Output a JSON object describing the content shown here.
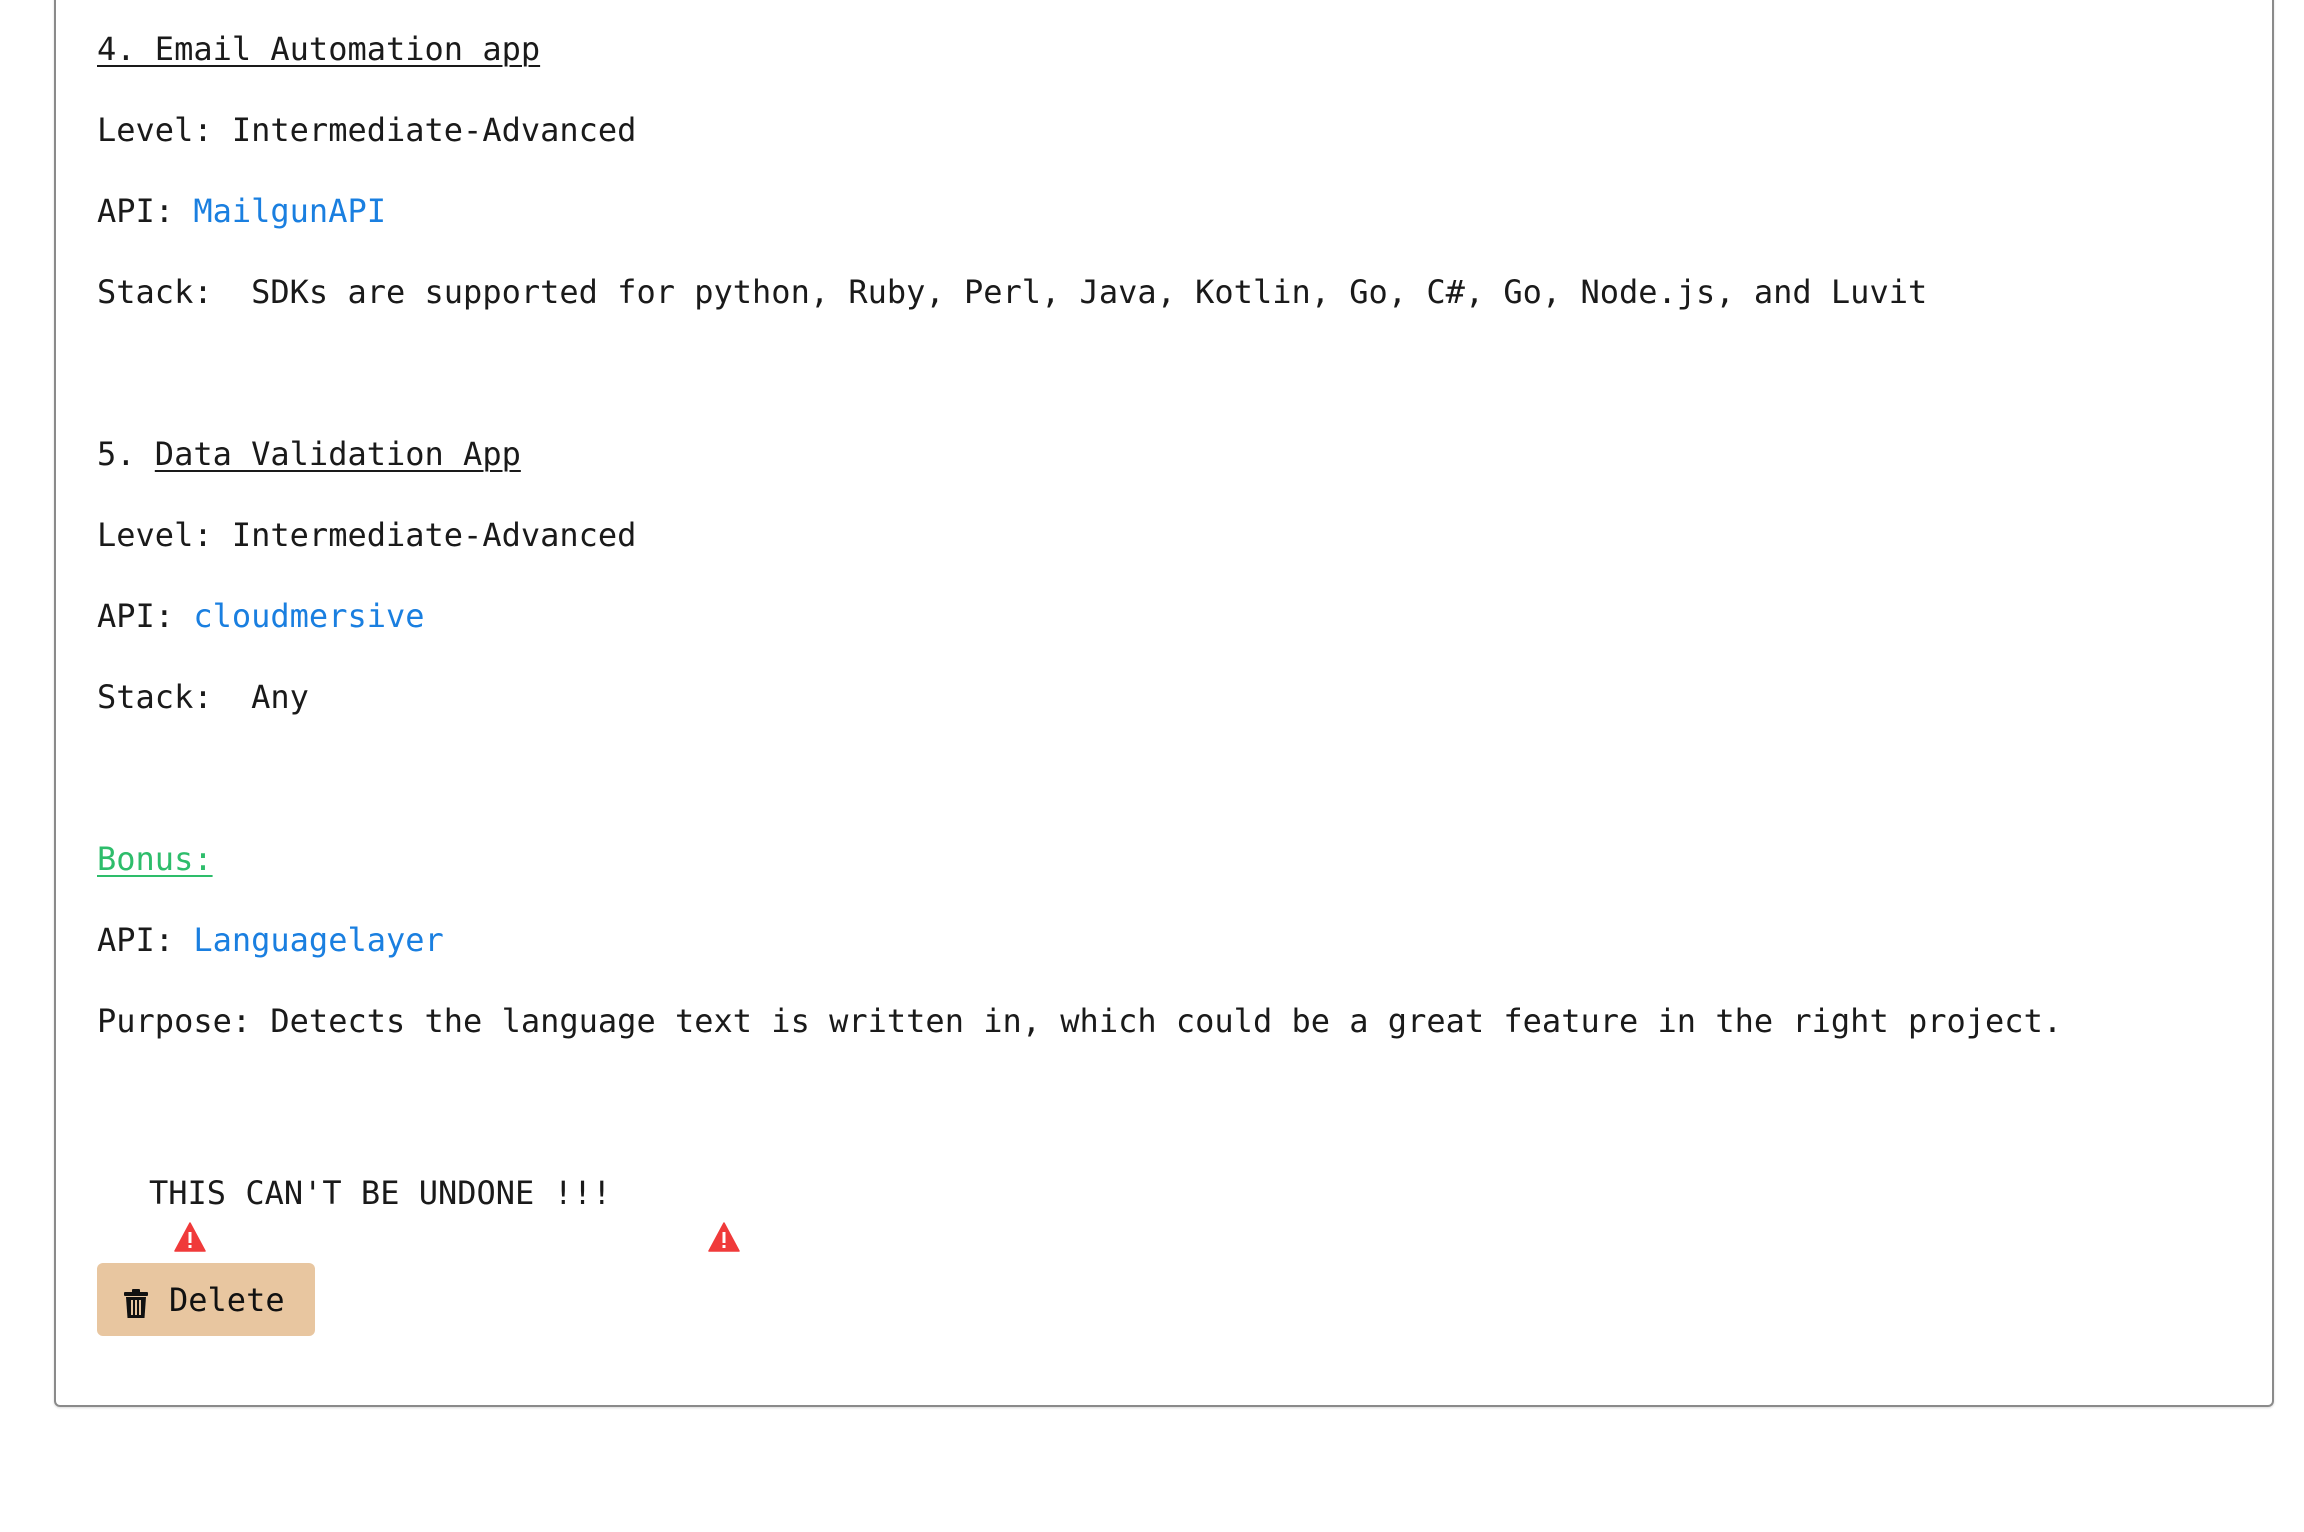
{
  "project4": {
    "number": "4. Email Automation app",
    "level": "Level: Intermediate-Advanced",
    "api_label": "API: ",
    "api_link": "MailgunAPI",
    "stack": "Stack:  SDKs are supported for python, Ruby, Perl, Java, Kotlin, Go, C#, Go, Node.js, and Luvit"
  },
  "project5": {
    "number_prefix": "5. ",
    "title": "Data Validation App",
    "level": "Level: Intermediate-Advanced",
    "api_label": "API: ",
    "api_link": "cloudmersive",
    "stack": "Stack:  Any"
  },
  "bonus": {
    "heading": "Bonus:",
    "api_label": "API: ",
    "api_link": "Languagelayer",
    "purpose": "Purpose: Detects the language text is written in, which could be a great feature in the right project."
  },
  "warning": {
    "text": "THIS CAN'T BE UNDONE !!!",
    "icon": "warning-triangle-icon",
    "icon_color": "#f03a3a"
  },
  "delete_button": {
    "label": "Delete",
    "icon": "trash-icon",
    "background": "#e8c6a0"
  },
  "colors": {
    "link": "#1a7fe0",
    "bonus": "#2ebd6b"
  }
}
